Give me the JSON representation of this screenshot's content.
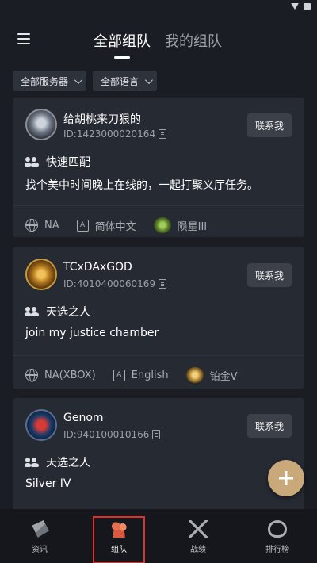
{
  "header": {
    "tabs": [
      {
        "label": "全部组队",
        "active": true
      },
      {
        "label": "我的组队",
        "active": false
      }
    ]
  },
  "filters": {
    "server": "全部服务器",
    "language": "全部语言"
  },
  "contact_label": "联系我",
  "posts": [
    {
      "name": "给胡桃来刀狠的",
      "id": "ID:1423000020164",
      "mode": "快速匹配",
      "message": "找个美中时间晚上在线的，一起打聚义厅任务。",
      "server": "NA",
      "language": "简体中文",
      "rank": "陨星III"
    },
    {
      "name": "TCxDAxGOD",
      "id": "ID:4010400060169",
      "mode": "天选之人",
      "message": "join my justice chamber",
      "server": "NA(XBOX)",
      "language": "English",
      "rank": "铂金V"
    },
    {
      "name": "Genom",
      "id": "ID:940100010166",
      "mode": "天选之人",
      "message": "Silver IV"
    }
  ],
  "bottom_nav": [
    {
      "label": "资讯",
      "icon": "news-icon"
    },
    {
      "label": "组队",
      "icon": "team-icon",
      "active": true
    },
    {
      "label": "战绩",
      "icon": "battle-record-icon"
    },
    {
      "label": "排行榜",
      "icon": "leaderboard-icon"
    }
  ],
  "colors": {
    "background": "#1a1d24",
    "card": "#262a32",
    "fab": "#c9a87a",
    "highlight": "#e0302a"
  }
}
